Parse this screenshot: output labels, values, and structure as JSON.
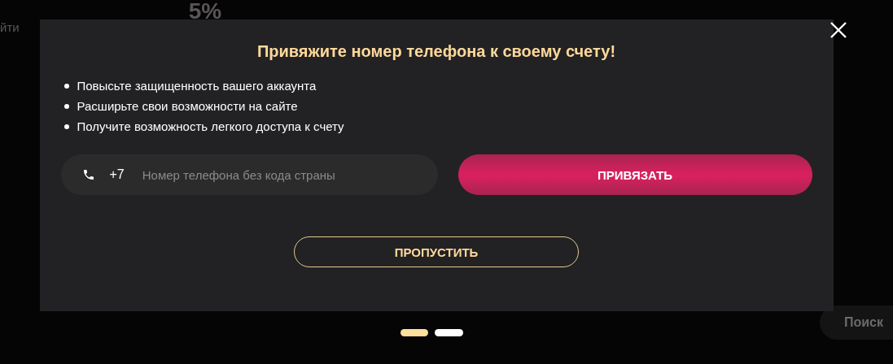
{
  "background": {
    "login_text": "йти",
    "percent": "5%",
    "search": "Поиск"
  },
  "modal": {
    "title": "Привяжите номер телефона к своему счету!",
    "benefits": [
      "Повысьте защищенность вашего аккаунта",
      "Расширьте свои возможности на сайте",
      "Получите возможность легкого доступа к счету"
    ],
    "phone": {
      "prefix": "+7",
      "placeholder": "Номер телефона без кода страны"
    },
    "submit": "ПРИВЯЗАТЬ",
    "skip": "ПРОПУСТИТЬ"
  },
  "pages": [
    {
      "selected": true
    },
    {
      "selected": false
    }
  ]
}
